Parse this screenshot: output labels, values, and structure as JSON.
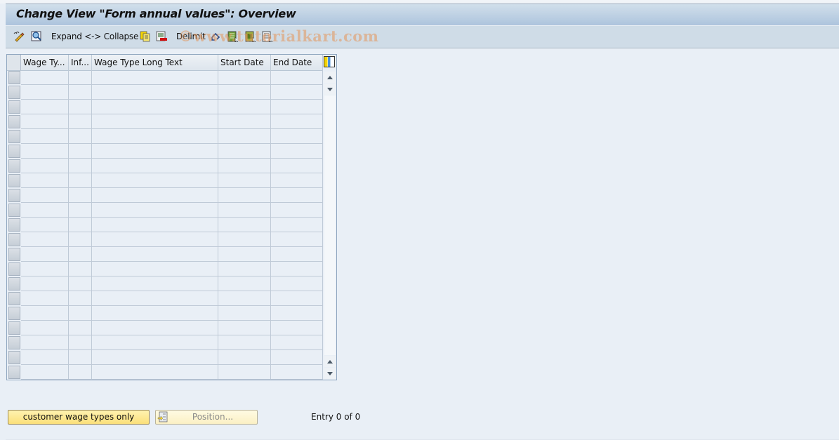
{
  "title": "Change View \"Form annual values\": Overview",
  "toolbar": {
    "items": [
      {
        "name": "display-change-icon",
        "label": ""
      },
      {
        "name": "find-icon",
        "label": ""
      },
      {
        "name": "expand-collapse",
        "label": "Expand <-> Collapse"
      },
      {
        "name": "copy-icon",
        "label": ""
      },
      {
        "name": "delete-icon",
        "label": ""
      },
      {
        "name": "delimit",
        "label": "Delimit"
      },
      {
        "name": "undo-icon",
        "label": ""
      },
      {
        "name": "select-all-icon",
        "label": ""
      },
      {
        "name": "select-block-icon",
        "label": ""
      },
      {
        "name": "deselect-all-icon",
        "label": ""
      }
    ],
    "watermark": "©www.tutorialkart.com"
  },
  "table": {
    "columns": [
      "Wage Ty...",
      "Inf...",
      "Wage Type Long Text",
      "Start Date",
      "End Date"
    ],
    "row_count": 21,
    "rows": []
  },
  "buttons": {
    "customer_wage_types": "customer wage types only",
    "position": "Position..."
  },
  "status": {
    "entry": "Entry 0 of 0"
  },
  "colors": {
    "background": "#e9eff6",
    "titlebar": "#adc4dd",
    "toolbar": "#cfdce7",
    "button_yellow": "#fbe07a",
    "watermark": "#e6965a"
  }
}
